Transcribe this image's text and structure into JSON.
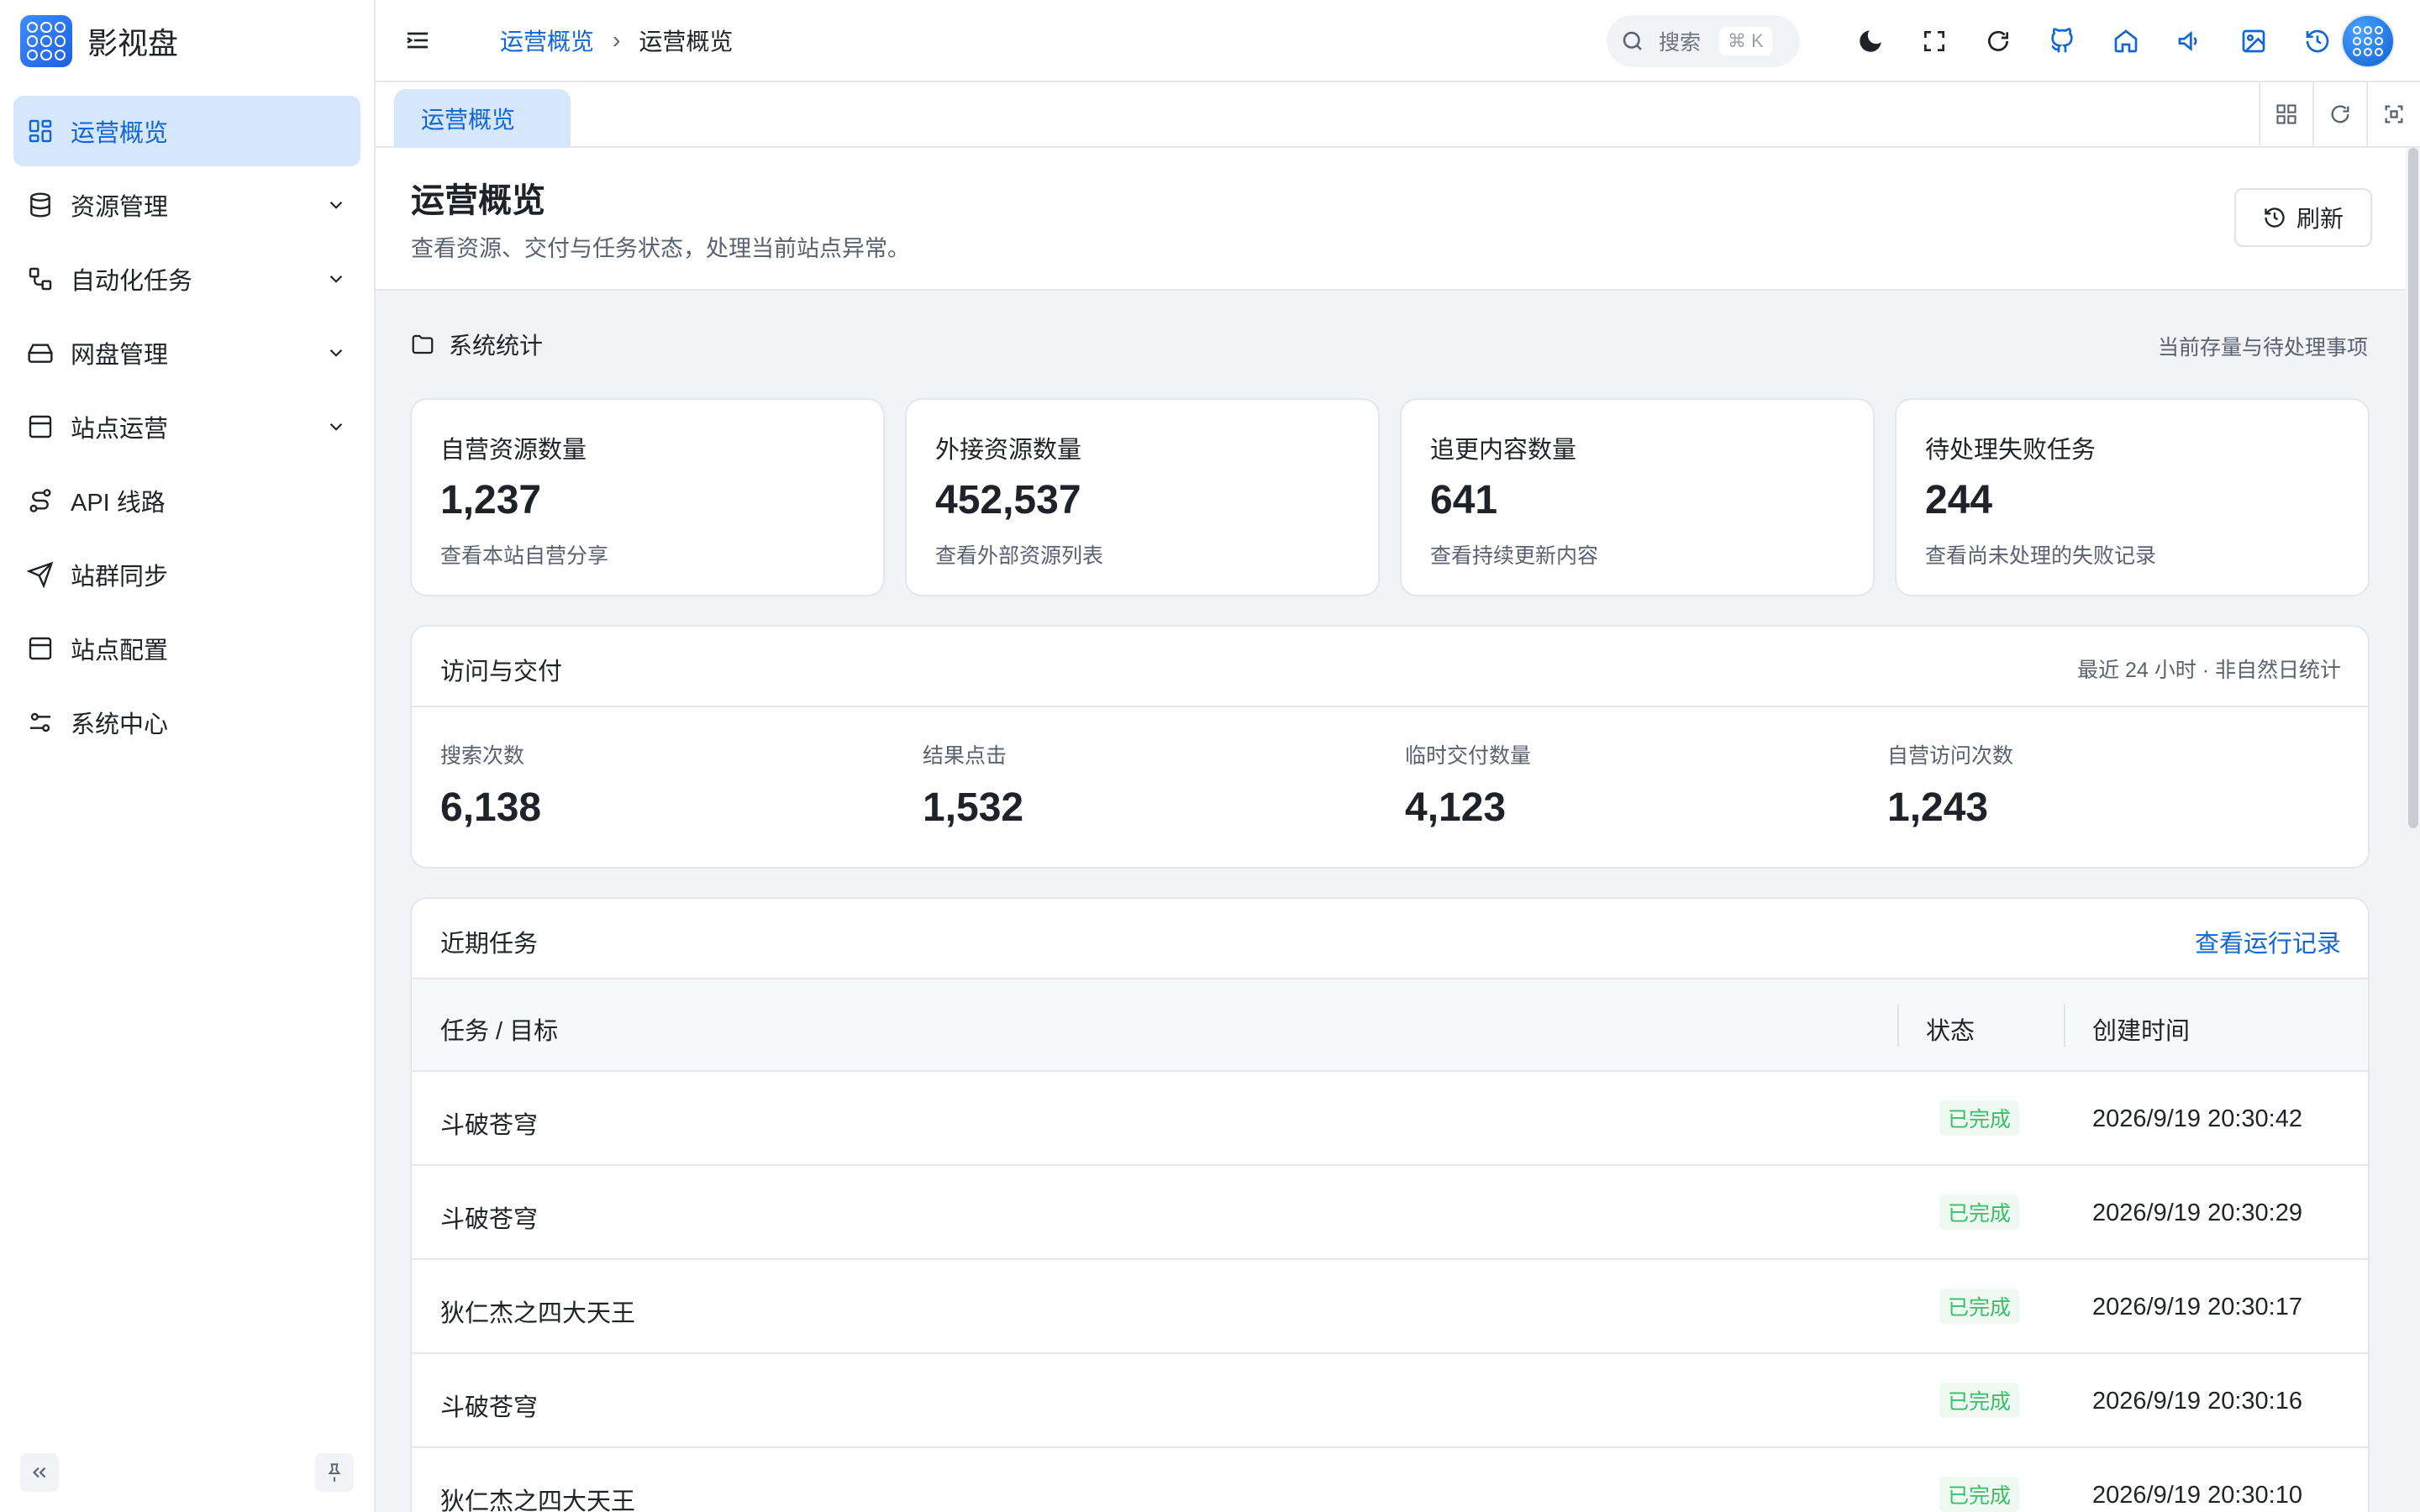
{
  "app": {
    "name": "影视盘",
    "logo_icon": "grid-logo-icon"
  },
  "sidebar": {
    "items": [
      {
        "label": "运营概览",
        "icon": "dashboard-icon",
        "active": true,
        "expandable": false
      },
      {
        "label": "资源管理",
        "icon": "database-icon",
        "active": false,
        "expandable": true
      },
      {
        "label": "自动化任务",
        "icon": "workflow-icon",
        "active": false,
        "expandable": true
      },
      {
        "label": "网盘管理",
        "icon": "harddrive-icon",
        "active": false,
        "expandable": true
      },
      {
        "label": "站点运营",
        "icon": "window-icon",
        "active": false,
        "expandable": true
      },
      {
        "label": "API 线路",
        "icon": "route-icon",
        "active": false,
        "expandable": false
      },
      {
        "label": "站群同步",
        "icon": "send-icon",
        "active": false,
        "expandable": false
      },
      {
        "label": "站点配置",
        "icon": "window-icon",
        "active": false,
        "expandable": false
      },
      {
        "label": "系统中心",
        "icon": "settings-sliders-icon",
        "active": false,
        "expandable": false
      }
    ]
  },
  "header": {
    "breadcrumb": [
      "运营概览",
      "运营概览"
    ],
    "search": {
      "label": "搜索",
      "shortcut": "⌘ K"
    }
  },
  "tabs": [
    {
      "label": "运营概览"
    }
  ],
  "page": {
    "title": "运营概览",
    "subtitle": "查看资源、交付与任务状态，处理当前站点异常。",
    "refresh_label": "刷新"
  },
  "stats_section": {
    "title": "系统统计",
    "note": "当前存量与待处理事项",
    "cards": [
      {
        "title": "自营资源数量",
        "value": "1,237",
        "sub": "查看本站自营分享"
      },
      {
        "title": "外接资源数量",
        "value": "452,537",
        "sub": "查看外部资源列表"
      },
      {
        "title": "追更内容数量",
        "value": "641",
        "sub": "查看持续更新内容"
      },
      {
        "title": "待处理失败任务",
        "value": "244",
        "sub": "查看尚未处理的失败记录"
      }
    ]
  },
  "visits": {
    "title": "访问与交付",
    "note": "最近 24 小时 · 非自然日统计",
    "metrics": [
      {
        "label": "搜索次数",
        "value": "6,138"
      },
      {
        "label": "结果点击",
        "value": "1,532"
      },
      {
        "label": "临时交付数量",
        "value": "4,123"
      },
      {
        "label": "自营访问次数",
        "value": "1,243"
      }
    ]
  },
  "tasks": {
    "title": "近期任务",
    "link_label": "查看运行记录",
    "columns": [
      "任务 / 目标",
      "状态",
      "创建时间"
    ],
    "rows": [
      {
        "task": "斗破苍穹",
        "status": "已完成",
        "time": "2026/9/19 20:30:42"
      },
      {
        "task": "斗破苍穹",
        "status": "已完成",
        "time": "2026/9/19 20:30:29"
      },
      {
        "task": "狄仁杰之四大天王",
        "status": "已完成",
        "time": "2026/9/19 20:30:17"
      },
      {
        "task": "斗破苍穹",
        "status": "已完成",
        "time": "2026/9/19 20:30:16"
      },
      {
        "task": "狄仁杰之四大天王",
        "status": "已完成",
        "time": "2026/9/19 20:30:10"
      }
    ]
  },
  "colors": {
    "accent": "#1266d4",
    "active_bg": "#d6e6fb",
    "success": "#3bbf6a"
  }
}
